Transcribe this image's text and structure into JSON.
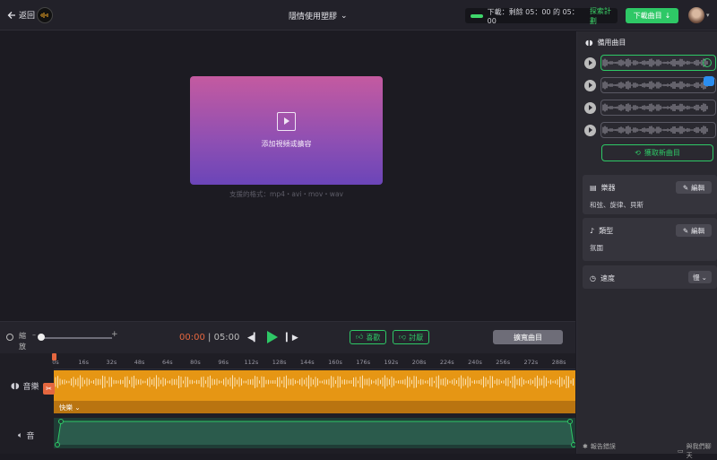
{
  "header": {
    "back_label": "返回",
    "title": "隱情使用塑膠",
    "download_status_prefix": "下載：剩餘 05：00 的 05：00",
    "plan_link": "探索計劃",
    "download_button": "下載曲目"
  },
  "preview": {
    "drop_text": "添加視頻或擴容",
    "formats": "支援的格式：mp4・avi・mov・wav"
  },
  "controls": {
    "zoom_label": "縮放",
    "current_time": "00:00",
    "separator": "|",
    "total_time": "05:00",
    "like_label": "喜歡",
    "dislike_label": "討厭",
    "similar_label": "擴寬曲目"
  },
  "timeline": {
    "ticks": [
      "0s",
      "16s",
      "32s",
      "48s",
      "64s",
      "80s",
      "96s",
      "112s",
      "128s",
      "144s",
      "160s",
      "176s",
      "192s",
      "208s",
      "224s",
      "240s",
      "256s",
      "272s",
      "288s"
    ],
    "music_label": "音樂",
    "volume_label": "音",
    "mood_label": "快樂"
  },
  "sidebar": {
    "alternates_title": "備用曲目",
    "generate_label": "獲取新曲目",
    "instruments_title": "樂器",
    "instruments_value": "和弦、旋律、貝斯",
    "genre_title": "類型",
    "genre_value": "氛圍",
    "speed_title": "速度",
    "speed_value": "慢",
    "edit_label": "編輯"
  },
  "footer": {
    "report_label": "報告錯誤",
    "chat_label": "與我們聊天"
  },
  "colors": {
    "accent": "#2ec866",
    "music_track": "#e69614",
    "playhead": "#e5673f",
    "dropzone_top": "#c45aa0",
    "dropzone_bottom": "#6b45b8"
  },
  "icons": [
    "back-arrow-icon",
    "logo-icon",
    "chevron-down-icon",
    "download-icon",
    "film-icon",
    "zoom-icon",
    "skip-back-icon",
    "play-icon",
    "skip-forward-icon",
    "thumbs-up-icon",
    "thumbs-down-icon",
    "scissors-icon",
    "volume-icon",
    "waveform-icon",
    "check-icon",
    "refresh-icon",
    "instrument-icon",
    "guitar-icon",
    "clock-icon",
    "bug-icon",
    "chat-icon",
    "pencil-icon"
  ]
}
